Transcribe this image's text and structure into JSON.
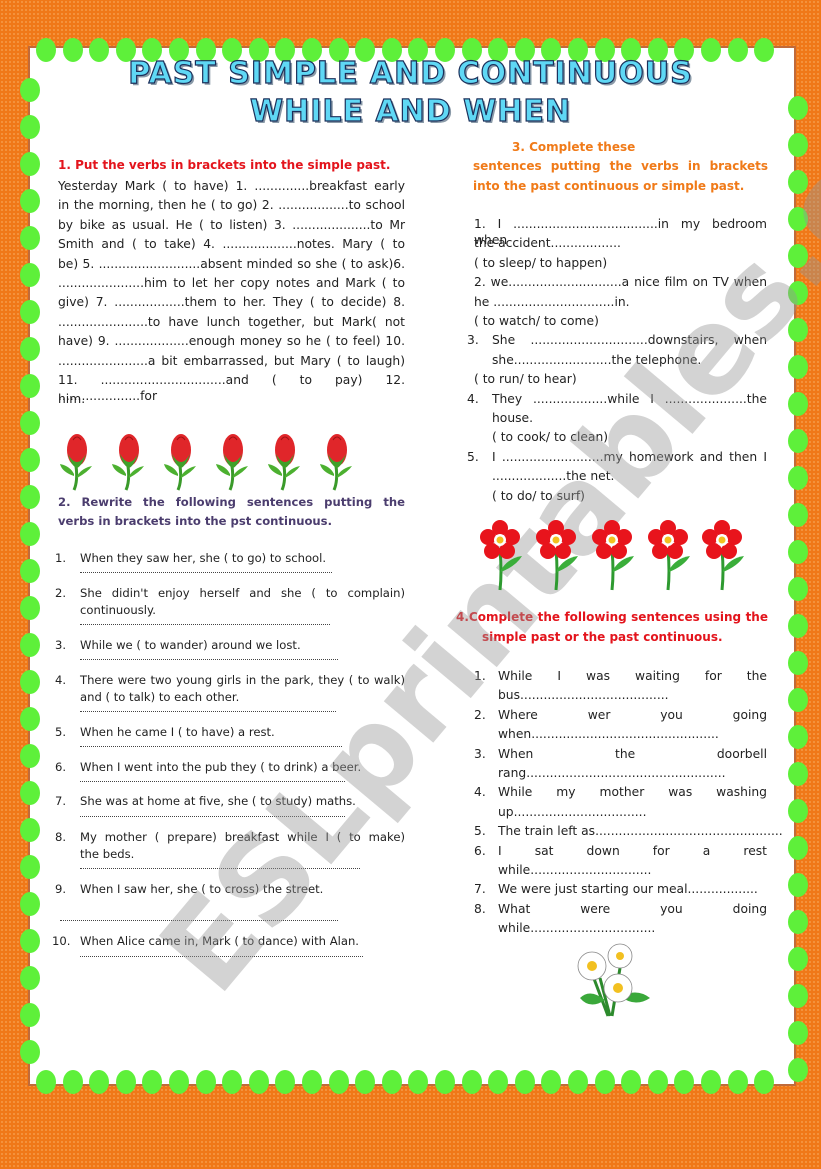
{
  "title": {
    "line1": "PAST SIMPLE AND CONTINUOUS",
    "line2": "WHILE AND WHEN"
  },
  "watermark": "ESLprintables.com",
  "colors": {
    "border": "#f07818",
    "dots": "#5ef03a",
    "title": "#5fd8f5",
    "heading1": "#e3141c",
    "heading2": "#4b3d6e",
    "heading3": "#f07a18",
    "heading4": "#e3141c"
  },
  "section1": {
    "heading": "1. Put the verbs in brackets into the simple past.",
    "lines": [
      "Yesterday Mark ( to have) 1. ..............breakfast early",
      "in the morning, then he ( to go) 2. ..................to school",
      "by bike as usual. He ( to listen) 3. ....................to Mr",
      "Smith and ( to take) 4. ...................notes. Mary ( to",
      "be) 5. ..........................absent minded so she ( to ask)6.",
      "......................him to let her copy notes and Mark ( to",
      "give) 7. ..................them to her. They ( to decide) 8.",
      ".......................to have lunch together, but Mark( not",
      "have) 9. ...................enough money so he  ( to feel) 10.",
      ".......................a bit embarrassed, but Mary ( to laugh)",
      "11. ................................and ( to pay) 12. .....................for",
      "him."
    ]
  },
  "section2": {
    "heading": [
      "2. Rewrite the following sentences putting the",
      "verbs in brackets into the pst continuous."
    ],
    "items": [
      {
        "num": "1.",
        "lines": [
          "When they saw her, she ( to go)  to school."
        ]
      },
      {
        "num": "2.",
        "lines": [
          "She didin't enjoy herself and she ( to complain)",
          "continuously."
        ]
      },
      {
        "num": "3.",
        "lines": [
          "While we ( to wander) around we lost."
        ]
      },
      {
        "num": "4.",
        "lines": [
          "There were two young girls in the park, they ( to walk)",
          "and ( to talk) to each other."
        ]
      },
      {
        "num": "5.",
        "lines": [
          "When he came I ( to have) a rest."
        ]
      },
      {
        "num": "6.",
        "lines": [
          "When I went into the pub they ( to drink) a beer."
        ]
      },
      {
        "num": "7.",
        "lines": [
          "She was at home at five, she ( to study) maths."
        ]
      },
      {
        "num": "8.",
        "lines": [
          "My mother ( prepare) breakfast while  I ( to  make)",
          "the beds."
        ]
      },
      {
        "num": "9.",
        "lines": [
          "When I saw her, she ( to cross) the street."
        ]
      },
      {
        "num": "10.",
        "lines": [
          "When Alice came in, Mark ( to dance) with Alan."
        ]
      }
    ]
  },
  "section3": {
    "heading": [
      "3. Complete these",
      "sentences putting the verbs in brackets",
      "into the past continuous or simple past."
    ],
    "items": [
      {
        "num": "",
        "lines": [
          "1. I .....................................in my bedroom when",
          "the accident.................."
        ],
        "hint": "( to sleep/ to happen)"
      },
      {
        "num": "",
        "lines": [
          "2. we.............................a nice film on TV when",
          "he ...............................in."
        ],
        "hint": "( to watch/ to come)"
      },
      {
        "num": "3.",
        "lines": [
          "She ..............................downstairs, when",
          "she.........................the telephone."
        ],
        "hint": "( to run/ to hear)"
      },
      {
        "num": "4.",
        "lines": [
          "They ...................while I .....................the",
          "house."
        ],
        "hint": "( to cook/ to clean)"
      },
      {
        "num": "5.",
        "lines": [
          "I ..........................my homework and then I",
          "...................the net."
        ],
        "hint": "( to do/ to surf)"
      }
    ]
  },
  "section4": {
    "heading": [
      "4.Complete the following sentences using the",
      "simple past or the past continuous."
    ],
    "items": [
      {
        "num": "1.",
        "lines": [
          "While I was waiting for the",
          "bus......................................"
        ]
      },
      {
        "num": "2.",
        "lines": [
          "Where wer you going",
          "when................................................"
        ]
      },
      {
        "num": "3.",
        "lines": [
          "When the doorbell",
          "rang..................................................."
        ]
      },
      {
        "num": "4.",
        "lines": [
          "While my mother was washing",
          "up.................................."
        ]
      },
      {
        "num": "5.",
        "lines": [
          "The train left as................................................"
        ]
      },
      {
        "num": "6.",
        "lines": [
          "I sat down for a rest",
          "while..............................."
        ]
      },
      {
        "num": "7.",
        "lines": [
          "We were just starting our meal.................."
        ]
      },
      {
        "num": "8.",
        "lines": [
          "What were you doing",
          "while................................"
        ]
      }
    ]
  }
}
